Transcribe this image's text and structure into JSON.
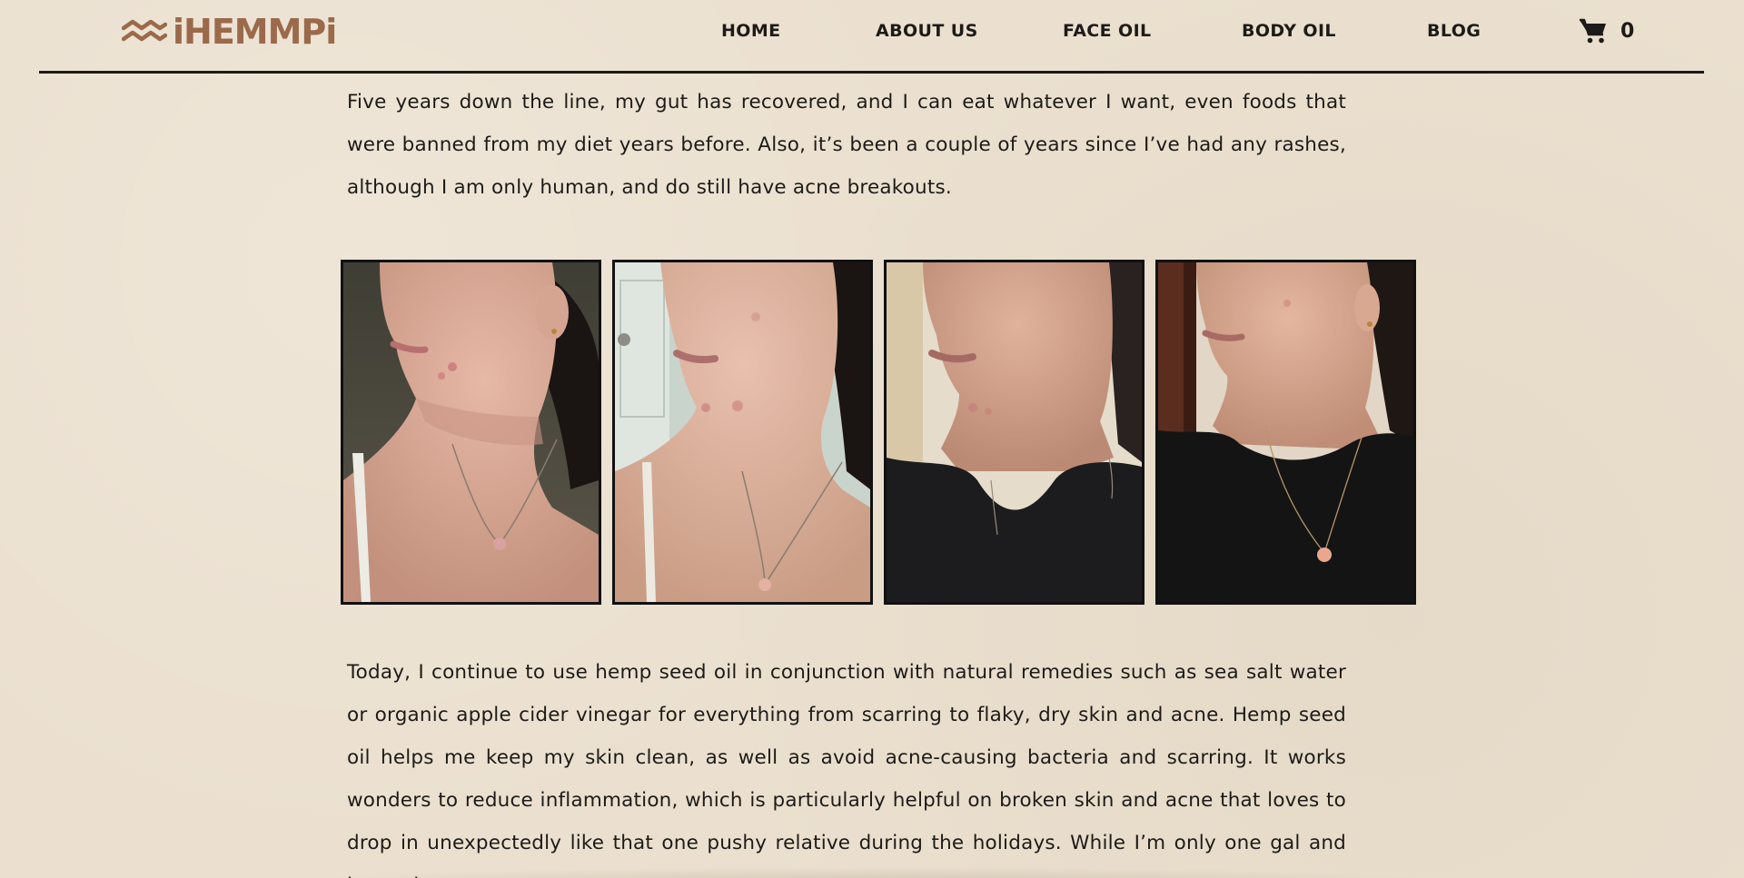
{
  "brand": {
    "name": "iHEMMPi",
    "logo_icon": "waves-logo-icon",
    "brand_color": "#9a6a4a"
  },
  "nav": {
    "items": [
      {
        "label": "HOME"
      },
      {
        "label": "ABOUT US"
      },
      {
        "label": "FACE OIL"
      },
      {
        "label": "BODY OIL"
      },
      {
        "label": "BLOG"
      }
    ]
  },
  "cart": {
    "icon": "shopping-cart-icon",
    "count": "0"
  },
  "article": {
    "paragraph_1": "Five years down the line, my gut has recovered, and I can eat whatever I want, even foods that were banned from my diet years before. Also, it’s been a couple of years since I’ve had any rashes, although I am only human, and do still have acne breakouts.",
    "paragraph_2": "Today, I continue to use hemp seed oil in conjunction with natural remedies such as sea salt water or organic apple cider vinegar for everything from scarring to flaky, dry skin and acne. Hemp seed oil helps me keep my skin clean, as well as avoid acne-causing bacteria and scarring. It works wonders to reduce inflammation, which is particularly helpful on broken skin and acne that loves to drop in unexpectedly like that one pushy relative during the holidays. While I’m only one gal and know that"
  },
  "gallery": {
    "photos": [
      {
        "subject": "face-profile-photo-1"
      },
      {
        "subject": "face-profile-photo-2"
      },
      {
        "subject": "face-profile-photo-3"
      },
      {
        "subject": "face-profile-photo-4"
      }
    ]
  },
  "colors": {
    "background": "#ebe0cf",
    "text": "#1d1b18"
  }
}
